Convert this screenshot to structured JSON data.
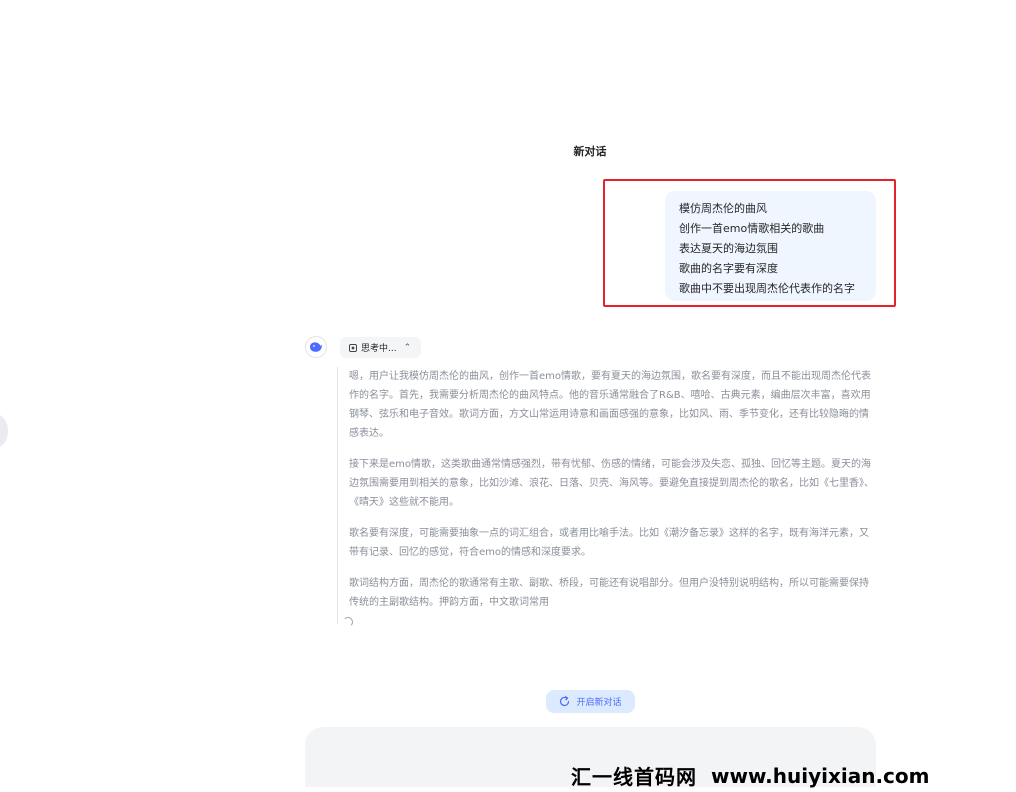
{
  "conversation": {
    "title": "新对话"
  },
  "user_message": {
    "lines": [
      "模仿周杰伦的曲风",
      "创作一首emo情歌相关的歌曲",
      "表达夏天的海边氛围",
      "歌曲的名字要有深度",
      "歌曲中不要出现周杰伦代表作的名字"
    ]
  },
  "assistant": {
    "thinking_label": "思考中...",
    "reasoning_paragraphs": [
      "嗯，用户让我模仿周杰伦的曲风，创作一首emo情歌，要有夏天的海边氛围，歌名要有深度，而且不能出现周杰伦代表作的名字。首先，我需要分析周杰伦的曲风特点。他的音乐通常融合了R&B、嘻哈、古典元素，编曲层次丰富，喜欢用钢琴、弦乐和电子音效。歌词方面，方文山常运用诗意和画面感强的意象，比如风、雨、季节变化，还有比较隐晦的情感表达。",
      "接下来是emo情歌，这类歌曲通常情感强烈，带有忧郁、伤感的情绪，可能会涉及失恋、孤独、回忆等主题。夏天的海边氛围需要用到相关的意象，比如沙滩、浪花、日落、贝壳、海风等。要避免直接提到周杰伦的歌名，比如《七里香》、《晴天》这些就不能用。",
      "歌名要有深度，可能需要抽象一点的词汇组合，或者用比喻手法。比如《潮汐备忘录》这样的名字，既有海洋元素，又带有记录、回忆的感觉，符合emo的情感和深度要求。",
      "歌词结构方面，周杰伦的歌通常有主歌、副歌、桥段，可能还有说唱部分。但用户没特别说明结构，所以可能需要保持传统的主副歌结构。押韵方面，中文歌词常用"
    ]
  },
  "actions": {
    "new_chat_label": "开启新对话"
  },
  "watermark": {
    "cn": "汇一线首码网",
    "url": "www.huiyixian.com"
  },
  "colors": {
    "accent": "#4d6bfe",
    "highlight_border": "#e3242b",
    "user_bubble": "#eff6ff",
    "reasoning_text": "#8a8f99"
  }
}
